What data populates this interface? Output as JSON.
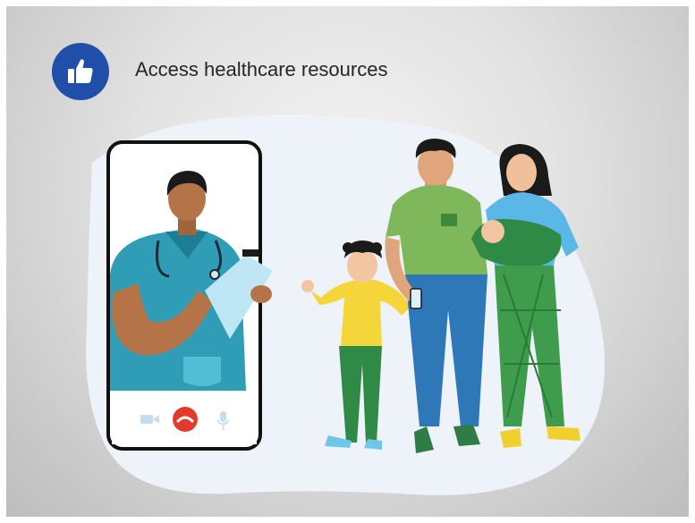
{
  "slide": {
    "title": "Access healthcare resources",
    "badge_icon": "thumbs-up-icon"
  },
  "illustration": {
    "subject": "telehealth video call",
    "call_controls": [
      "video-camera-icon",
      "end-call-icon",
      "microphone-icon"
    ]
  },
  "colors": {
    "badge": "#1f4fa8",
    "blob": "#eef3fa",
    "scrubs": "#2f9db5",
    "end_call": "#e23b2e"
  }
}
